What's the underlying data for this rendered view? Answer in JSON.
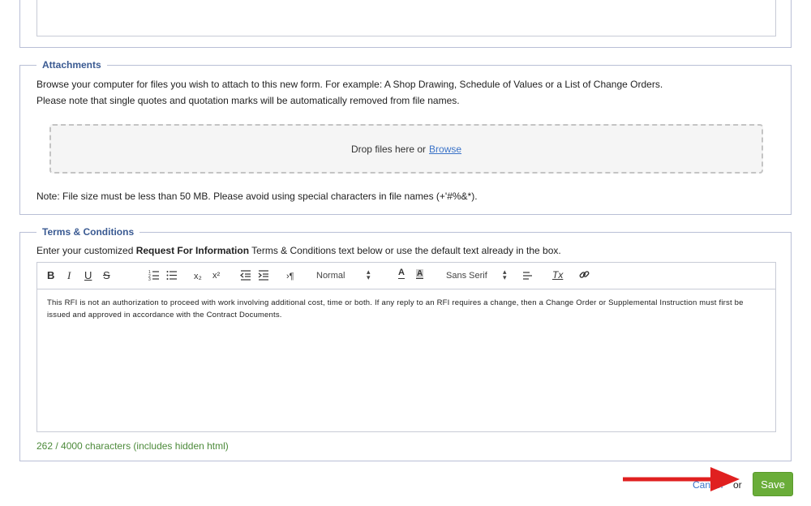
{
  "attachments": {
    "legend": "Attachments",
    "line1": "Browse your computer for files you wish to attach to this new form. For example: A Shop Drawing, Schedule of Values or a List of Change Orders.",
    "line2": "Please note that single quotes and quotation marks will be automatically removed from file names.",
    "drop_text": "Drop files here or",
    "browse_label": "Browse",
    "note": "Note: File size must be less than 50 MB. Please avoid using special characters in file names (+'#%&*)."
  },
  "terms": {
    "legend": "Terms & Conditions",
    "intro_before": "Enter your customized ",
    "intro_bold": "Request For Information",
    "intro_after": " Terms & Conditions text below or use the default text already in the box.",
    "toolbar": {
      "bold": "B",
      "italic": "I",
      "underline": "U",
      "strike": "S",
      "sub": "x₂",
      "sup": "x²",
      "rtl": "›¶",
      "heading_value": "Normal",
      "font_value": "Sans Serif",
      "font_color": "A",
      "bg_color": "A",
      "clean": "Tx"
    },
    "content": "This RFI is not an authorization to proceed with work involving additional cost, time or both.  If any reply to an RFI requires a change, then a Change Order or Supplemental Instruction must first be issued and approved in accordance with the Contract Documents.",
    "char_count": "262 / 4000 characters (includes hidden html)"
  },
  "footer": {
    "cancel_label": "Cancel",
    "or_label": "or",
    "save_label": "Save"
  },
  "colors": {
    "legend": "#3a5a92",
    "save": "#6aad39",
    "link": "#3b73c8",
    "count": "#4c8a3a",
    "arrow": "#e02020"
  },
  "icons": [
    "ordered-list-icon",
    "bullet-list-icon",
    "outdent-icon",
    "indent-icon",
    "align-icon",
    "link-icon",
    "arrow-icon"
  ]
}
